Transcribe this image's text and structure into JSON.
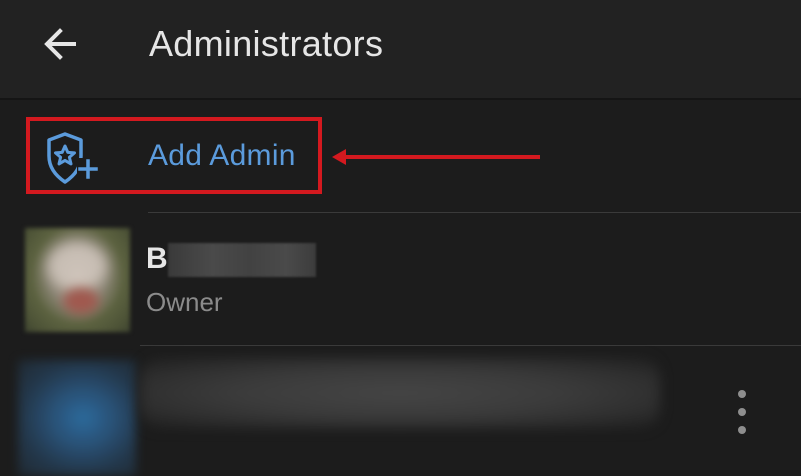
{
  "header": {
    "title": "Administrators",
    "back_icon": "arrow-left-icon"
  },
  "add_admin": {
    "label": "Add Admin",
    "icon": "shield-star-plus-icon"
  },
  "admins": [
    {
      "name": "B",
      "role": "Owner"
    },
    {
      "name": "",
      "role": ""
    }
  ],
  "colors": {
    "background": "#1c1c1c",
    "header_background": "#222222",
    "accent": "#5b9bdc",
    "highlight_annotation": "#d4191f",
    "primary_text": "#e6e6e6",
    "secondary_text": "#8b8b8b"
  }
}
